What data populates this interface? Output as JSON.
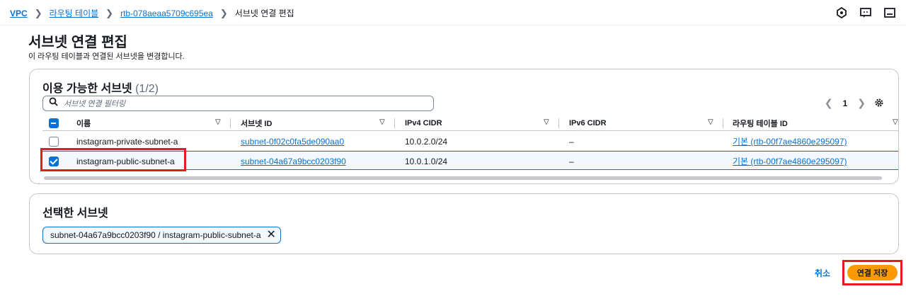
{
  "breadcrumb": {
    "items": [
      "VPC",
      "라우팅 테이블",
      "rtb-078aeaa5709c695ea"
    ],
    "current": "서브넷 연결 편집"
  },
  "page": {
    "title": "서브넷 연결 편집",
    "description": "이 라우팅 테이블과 연결된 서브넷을 변경합니다."
  },
  "available": {
    "title": "이용 가능한 서브넷",
    "count": "(1/2)",
    "filter_placeholder": "서브넷 연결 필터링",
    "page_number": "1",
    "columns": [
      "이름",
      "서브넷 ID",
      "IPv4 CIDR",
      "IPv6 CIDR",
      "라우팅 테이블 ID"
    ],
    "rows": [
      {
        "checked": false,
        "name": "instagram-private-subnet-a",
        "subnet_id": "subnet-0f02c0fa5de090aa0",
        "ipv4": "10.0.2.0/24",
        "ipv6": "–",
        "route_table": "기본 (rtb-00f7ae4860e295097)"
      },
      {
        "checked": true,
        "name": "instagram-public-subnet-a",
        "subnet_id": "subnet-04a67a9bcc0203f90",
        "ipv4": "10.0.1.0/24",
        "ipv6": "–",
        "route_table": "기본 (rtb-00f7ae4860e295097)"
      }
    ]
  },
  "selected": {
    "title": "선택한 서브넷",
    "token": "subnet-04a67a9bcc0203f90 / instagram-public-subnet-a"
  },
  "actions": {
    "cancel": "취소",
    "save": "연결 저장"
  },
  "colors": {
    "link": "#0972d3",
    "primary_button": "#ff9900",
    "highlight_box": "#e01e1e"
  }
}
